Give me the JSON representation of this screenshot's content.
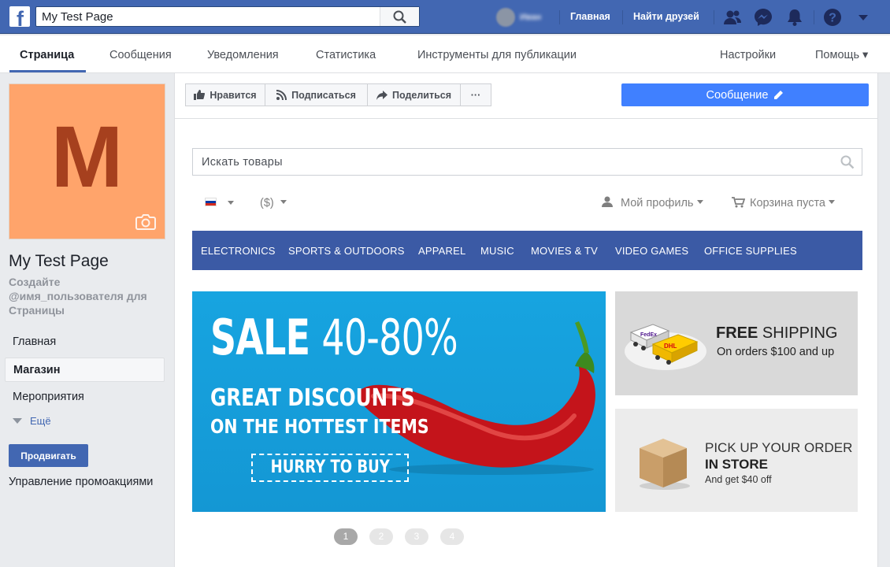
{
  "topbar": {
    "search_value": "My Test Page",
    "username": "Иван",
    "links": [
      "Главная",
      "Найти друзей"
    ]
  },
  "pagenav": {
    "tabs": [
      "Страница",
      "Сообщения",
      "Уведомления",
      "Статистика",
      "Инструменты для публикации"
    ],
    "right": [
      "Настройки",
      "Помощь ▾"
    ]
  },
  "sidebar": {
    "avatar_letter": "M",
    "page_name": "My Test Page",
    "username_prompt": "Создайте @имя_пользователя для Страницы",
    "items": [
      "Главная",
      "Магазин",
      "Мероприятия"
    ],
    "more": "Ещё",
    "promote": "Продвигать",
    "manage_promotions": "Управление промоакциями"
  },
  "actions": {
    "like": "Нравится",
    "follow": "Подписаться",
    "share": "Поделиться",
    "more": "···",
    "message": "Сообщение"
  },
  "shop": {
    "search_placeholder": "Искать товары",
    "currency": "($)",
    "profile": "Мой профиль",
    "cart": "Корзина пуста",
    "categories": [
      "ELECTRONICS",
      "SPORTS & OUTDOORS",
      "APPAREL",
      "MUSIC",
      "MOVIES & TV",
      "VIDEO GAMES",
      "OFFICE SUPPLIES"
    ],
    "banner": {
      "sale": "SALE",
      "percent": "40-80%",
      "line1": "GREAT DISCOUNTS",
      "line2": "ON THE HOTTEST ITEMS",
      "cta": "HURRY TO BUY"
    },
    "promo1": {
      "title_bold": "FREE",
      "title_rest": "SHIPPING",
      "subtitle": "On orders $100 and up"
    },
    "promo2": {
      "line1": "PICK UP YOUR ORDER",
      "line2": "IN STORE",
      "line3": "And get $40 off"
    },
    "pages": [
      "1",
      "2",
      "3",
      "4"
    ],
    "active_page": "1"
  },
  "colors": {
    "fb_blue": "#4267b2",
    "message_blue": "#4080ff",
    "category_bar": "#3b5aa5",
    "avatar_bg": "#ffa46b",
    "avatar_letter": "#a6401e",
    "banner_bg": "#17a4e0"
  }
}
